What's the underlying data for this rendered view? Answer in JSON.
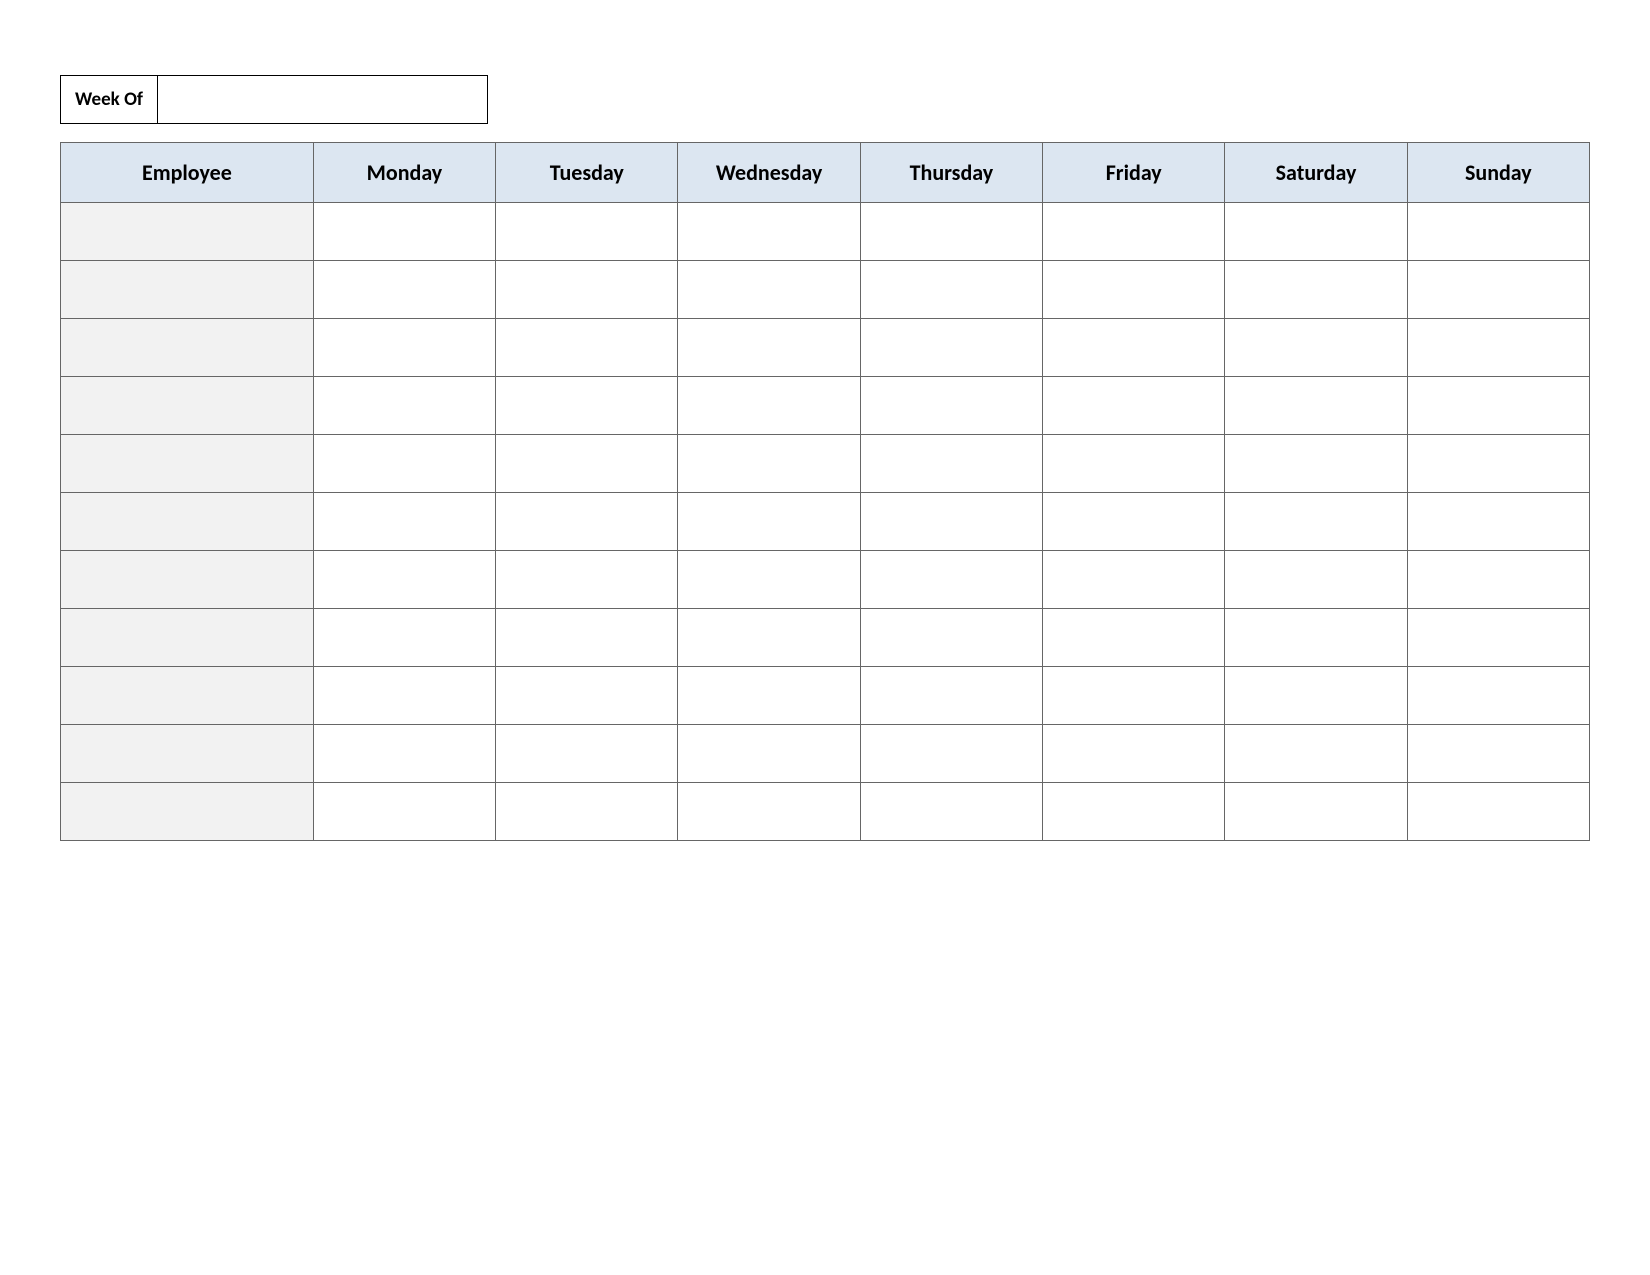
{
  "weekOf": {
    "label": "Week Of",
    "value": ""
  },
  "headers": {
    "employee": "Employee",
    "days": [
      "Monday",
      "Tuesday",
      "Wednesday",
      "Thursday",
      "Friday",
      "Saturday",
      "Sunday"
    ]
  },
  "rows": [
    {
      "employee": "",
      "cells": [
        "",
        "",
        "",
        "",
        "",
        "",
        ""
      ]
    },
    {
      "employee": "",
      "cells": [
        "",
        "",
        "",
        "",
        "",
        "",
        ""
      ]
    },
    {
      "employee": "",
      "cells": [
        "",
        "",
        "",
        "",
        "",
        "",
        ""
      ]
    },
    {
      "employee": "",
      "cells": [
        "",
        "",
        "",
        "",
        "",
        "",
        ""
      ]
    },
    {
      "employee": "",
      "cells": [
        "",
        "",
        "",
        "",
        "",
        "",
        ""
      ]
    },
    {
      "employee": "",
      "cells": [
        "",
        "",
        "",
        "",
        "",
        "",
        ""
      ]
    },
    {
      "employee": "",
      "cells": [
        "",
        "",
        "",
        "",
        "",
        "",
        ""
      ]
    },
    {
      "employee": "",
      "cells": [
        "",
        "",
        "",
        "",
        "",
        "",
        ""
      ]
    },
    {
      "employee": "",
      "cells": [
        "",
        "",
        "",
        "",
        "",
        "",
        ""
      ]
    },
    {
      "employee": "",
      "cells": [
        "",
        "",
        "",
        "",
        "",
        "",
        ""
      ]
    },
    {
      "employee": "",
      "cells": [
        "",
        "",
        "",
        "",
        "",
        "",
        ""
      ]
    }
  ]
}
